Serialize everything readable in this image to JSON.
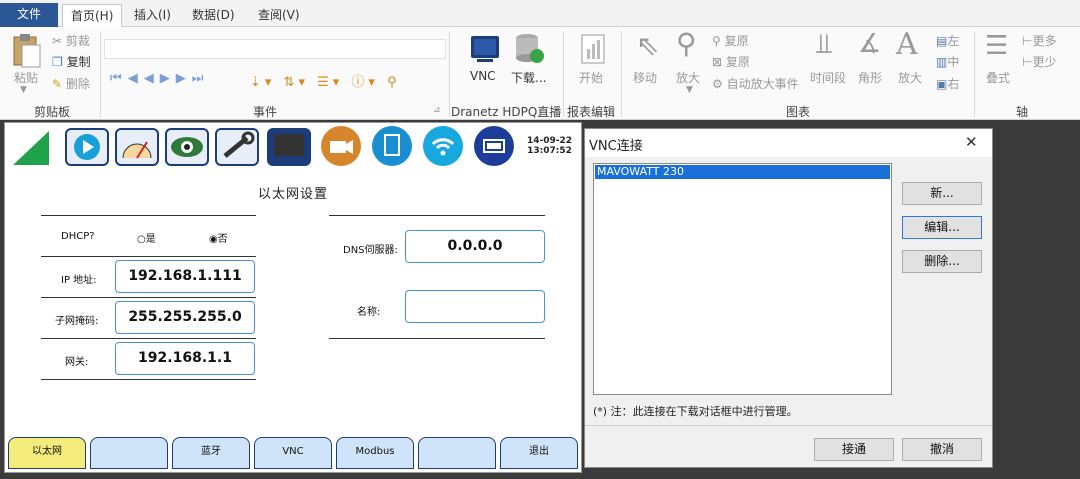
{
  "ribbon": {
    "tabs": [
      "文件",
      "首页(H)",
      "插入(I)",
      "数据(D)",
      "查阅(V)"
    ],
    "clipboard": {
      "paste": "粘贴",
      "cut": "剪裁",
      "copy": "复制",
      "delete": "删除",
      "title": "剪贴板"
    },
    "events": {
      "title": "事件"
    },
    "live": {
      "vnc": "VNC",
      "download": "下载...",
      "title": "Dranetz HDPQ直播"
    },
    "report": {
      "start": "开始",
      "title": "报表编辑"
    },
    "chart": {
      "move": "移动",
      "zoom": "放大",
      "restore1": "复原",
      "restore2": "复原",
      "auto_zoom": "自动放大事件",
      "timeseg": "时间段",
      "angle": "角形",
      "enlarge": "放大",
      "left": "左",
      "center": "中",
      "right": "右",
      "title": "图表"
    },
    "axis": {
      "overlay": "叠式",
      "more": "更多",
      "less": "更少",
      "title": "轴"
    }
  },
  "device": {
    "datetime_date": "14-09-22",
    "datetime_time": "13:07:52",
    "title": "以太网设置",
    "dhcp_label": "DHCP?",
    "dhcp_yes": "是",
    "dhcp_no": "否",
    "ip_label": "IP 地址:",
    "ip_value": "192.168.1.111",
    "mask_label": "子网掩码:",
    "mask_value": "255.255.255.0",
    "gateway_label": "网关:",
    "gateway_value": "192.168.1.1",
    "dns_label": "DNS伺服器:",
    "dns_value": "0.0.0.0",
    "name_label": "名称:",
    "name_value": "",
    "tabs": [
      "以太网",
      "",
      "蓝牙",
      "VNC",
      "Modbus",
      "",
      "退出"
    ]
  },
  "dialog": {
    "title": "VNC连接",
    "close": "✕",
    "list_items": [
      "MAVOWATT 230"
    ],
    "btn_new": "新...",
    "btn_edit": "编辑...",
    "btn_delete": "删除...",
    "note": "(*) 注：此连接在下载对话框中进行管理。",
    "btn_connect": "接通",
    "btn_cancel": "撤消"
  }
}
